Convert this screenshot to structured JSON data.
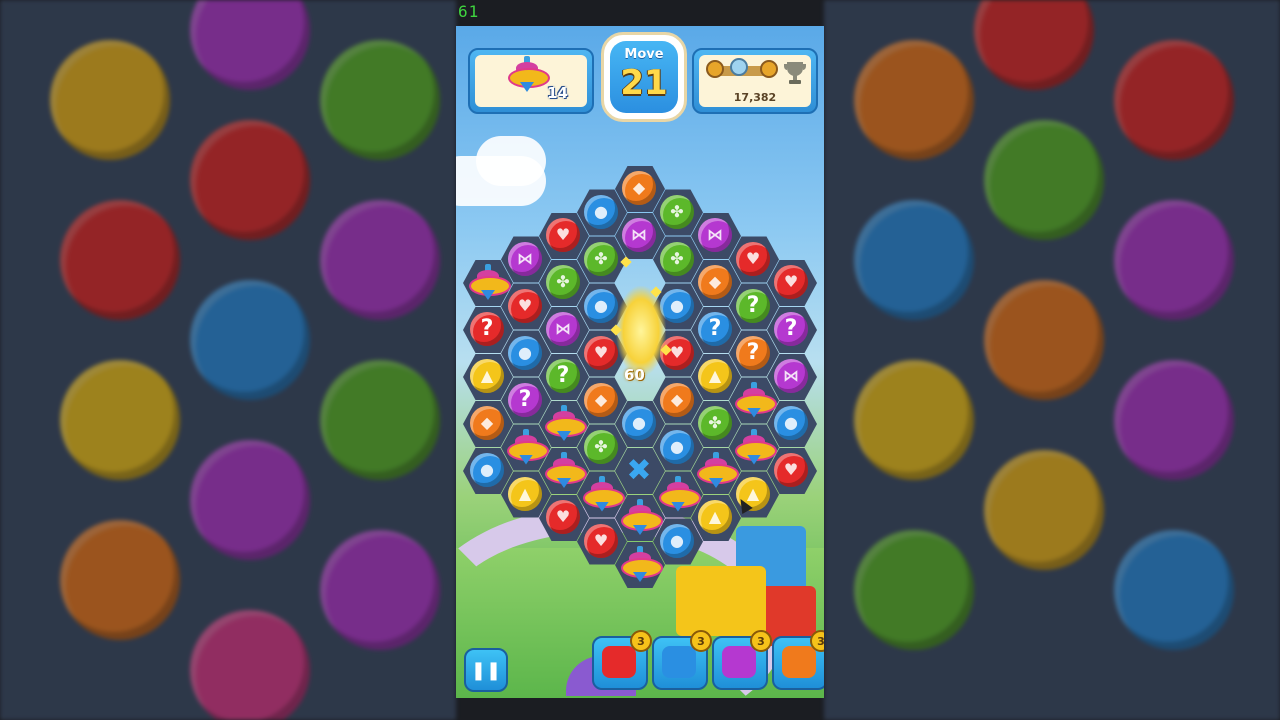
{
  "fps": "61",
  "hud": {
    "goal_count": "14",
    "move_label": "Move",
    "moves_left": "21",
    "score": "17,382"
  },
  "combo_points": "60",
  "boosters": [
    {
      "name": "boxing-glove",
      "count": "3",
      "color": "#e52a2a"
    },
    {
      "name": "hammer",
      "count": "3",
      "color": "#2a8fe2"
    },
    {
      "name": "bow-ribbon",
      "count": "3",
      "color": "#b538d0"
    },
    {
      "name": "horn",
      "count": "3",
      "color": "#f07a1c"
    }
  ],
  "colors": {
    "red": "#e52a2a",
    "green": "#5cb82a",
    "blue": "#2a8fe2",
    "purple": "#b538d0",
    "orange": "#f07a1c",
    "yellow": "#f4c51a"
  },
  "board": [
    {
      "col": 4,
      "row": 0,
      "t": "orange"
    },
    {
      "col": 3,
      "row": 1,
      "t": "blue"
    },
    {
      "col": 5,
      "row": 1,
      "t": "green"
    },
    {
      "col": 2,
      "row": 2,
      "t": "red"
    },
    {
      "col": 4,
      "row": 2,
      "t": "purple"
    },
    {
      "col": 6,
      "row": 2,
      "t": "purple"
    },
    {
      "col": 1,
      "row": 3,
      "t": "purple"
    },
    {
      "col": 3,
      "row": 3,
      "t": "green"
    },
    {
      "col": 5,
      "row": 3,
      "t": "green"
    },
    {
      "col": 7,
      "row": 3,
      "t": "red"
    },
    {
      "col": 0,
      "row": 4,
      "t": "top"
    },
    {
      "col": 2,
      "row": 4,
      "t": "green"
    },
    {
      "col": 6,
      "row": 4,
      "t": "orange"
    },
    {
      "col": 8,
      "row": 4,
      "t": "red"
    },
    {
      "col": 1,
      "row": 5,
      "t": "red"
    },
    {
      "col": 3,
      "row": 5,
      "t": "blue"
    },
    {
      "col": 5,
      "row": 5,
      "t": "blue"
    },
    {
      "col": 7,
      "row": 5,
      "t": "green-q"
    },
    {
      "col": 0,
      "row": 6,
      "t": "red-q"
    },
    {
      "col": 2,
      "row": 6,
      "t": "purple"
    },
    {
      "col": 6,
      "row": 6,
      "t": "blue-q"
    },
    {
      "col": 8,
      "row": 6,
      "t": "purple-q"
    },
    {
      "col": 1,
      "row": 7,
      "t": "blue"
    },
    {
      "col": 3,
      "row": 7,
      "t": "red"
    },
    {
      "col": 5,
      "row": 7,
      "t": "red"
    },
    {
      "col": 7,
      "row": 7,
      "t": "orange-q"
    },
    {
      "col": 0,
      "row": 8,
      "t": "yellow"
    },
    {
      "col": 2,
      "row": 8,
      "t": "green-q"
    },
    {
      "col": 6,
      "row": 8,
      "t": "yellow"
    },
    {
      "col": 8,
      "row": 8,
      "t": "purple"
    },
    {
      "col": 1,
      "row": 9,
      "t": "purple-q"
    },
    {
      "col": 3,
      "row": 9,
      "t": "orange"
    },
    {
      "col": 5,
      "row": 9,
      "t": "orange"
    },
    {
      "col": 7,
      "row": 9,
      "t": "top"
    },
    {
      "col": 0,
      "row": 10,
      "t": "orange"
    },
    {
      "col": 2,
      "row": 10,
      "t": "top"
    },
    {
      "col": 4,
      "row": 10,
      "t": "blue"
    },
    {
      "col": 6,
      "row": 10,
      "t": "green"
    },
    {
      "col": 8,
      "row": 10,
      "t": "blue"
    },
    {
      "col": 1,
      "row": 11,
      "t": "top"
    },
    {
      "col": 3,
      "row": 11,
      "t": "green"
    },
    {
      "col": 5,
      "row": 11,
      "t": "blue"
    },
    {
      "col": 7,
      "row": 11,
      "t": "top"
    },
    {
      "col": 0,
      "row": 12,
      "t": "blue"
    },
    {
      "col": 2,
      "row": 12,
      "t": "top"
    },
    {
      "col": 4,
      "row": 12,
      "t": "x"
    },
    {
      "col": 6,
      "row": 12,
      "t": "top"
    },
    {
      "col": 8,
      "row": 12,
      "t": "red"
    },
    {
      "col": 1,
      "row": 13,
      "t": "yellow"
    },
    {
      "col": 3,
      "row": 13,
      "t": "top"
    },
    {
      "col": 5,
      "row": 13,
      "t": "top"
    },
    {
      "col": 7,
      "row": 13,
      "t": "yellow"
    },
    {
      "col": 2,
      "row": 14,
      "t": "red"
    },
    {
      "col": 4,
      "row": 14,
      "t": "top"
    },
    {
      "col": 6,
      "row": 14,
      "t": "yellow"
    },
    {
      "col": 3,
      "row": 15,
      "t": "red"
    },
    {
      "col": 5,
      "row": 15,
      "t": "blue"
    },
    {
      "col": 4,
      "row": 16,
      "t": "top"
    }
  ],
  "icons": {
    "pause": "pause-icon",
    "goal": "spinning-top-icon",
    "trophy": "trophy-icon"
  }
}
